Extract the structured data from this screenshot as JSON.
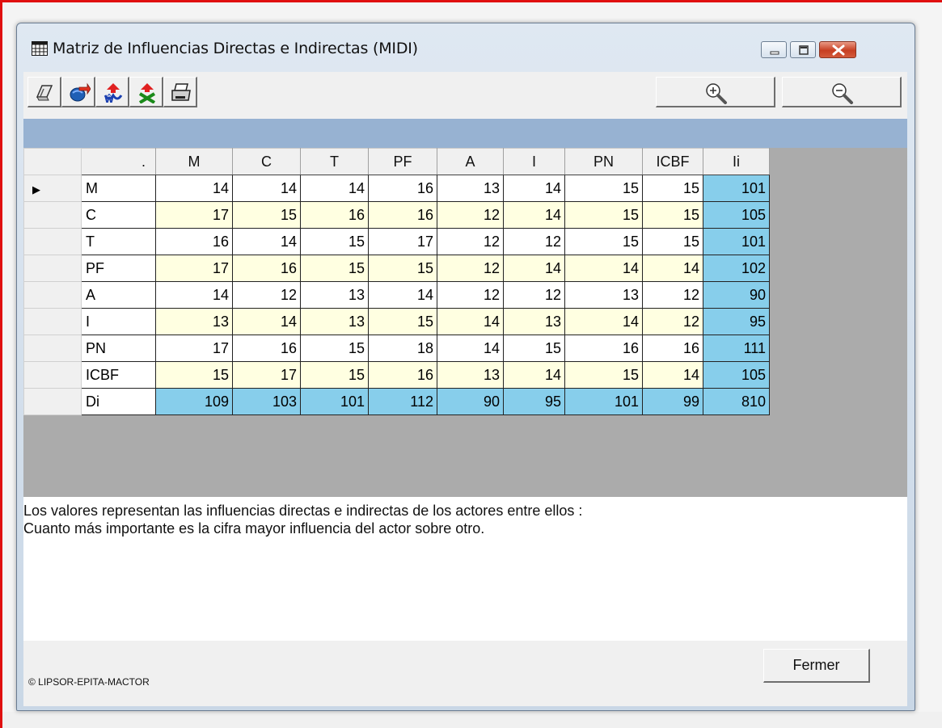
{
  "window": {
    "title": "Matriz de Influencias Directas e Indirectas (MIDI)"
  },
  "toolbar": {
    "buttons": [
      {
        "icon": "copy-icon"
      },
      {
        "icon": "export-icon"
      },
      {
        "icon": "influence-up-icon"
      },
      {
        "icon": "influence-cross-icon"
      },
      {
        "icon": "print-icon"
      }
    ],
    "zoom_in_icon": "zoom-in-icon",
    "zoom_out_icon": "zoom-out-icon"
  },
  "grid": {
    "corner_label": ".",
    "columns": [
      "M",
      "C",
      "T",
      "PF",
      "A",
      "I",
      "PN",
      "ICBF",
      "Ii"
    ],
    "rows": [
      {
        "label": "M",
        "values": [
          "14",
          "14",
          "14",
          "16",
          "13",
          "14",
          "15",
          "15",
          "101"
        ]
      },
      {
        "label": "C",
        "values": [
          "17",
          "15",
          "16",
          "16",
          "12",
          "14",
          "15",
          "15",
          "105"
        ]
      },
      {
        "label": "T",
        "values": [
          "16",
          "14",
          "15",
          "17",
          "12",
          "12",
          "15",
          "15",
          "101"
        ]
      },
      {
        "label": "PF",
        "values": [
          "17",
          "16",
          "15",
          "15",
          "12",
          "14",
          "14",
          "14",
          "102"
        ]
      },
      {
        "label": "A",
        "values": [
          "14",
          "12",
          "13",
          "14",
          "12",
          "12",
          "13",
          "12",
          "90"
        ]
      },
      {
        "label": "I",
        "values": [
          "13",
          "14",
          "13",
          "15",
          "14",
          "13",
          "14",
          "12",
          "95"
        ]
      },
      {
        "label": "PN",
        "values": [
          "17",
          "16",
          "15",
          "18",
          "14",
          "15",
          "16",
          "16",
          "111"
        ]
      },
      {
        "label": "ICBF",
        "values": [
          "15",
          "17",
          "15",
          "16",
          "13",
          "14",
          "15",
          "14",
          "105"
        ]
      },
      {
        "label": "Di",
        "values": [
          "109",
          "103",
          "101",
          "112",
          "90",
          "95",
          "101",
          "99",
          "810"
        ]
      }
    ],
    "selected_row_marker": "▶",
    "colors": {
      "total": "#87ceeb",
      "band": "#97b2d2",
      "alt_row": "#ffffe1"
    }
  },
  "description": {
    "line1": "Los valores representan las influencias directas e indirectas de los actores entre ellos :",
    "line2": "Cuanto más importante es la cifra mayor influencia del actor sobre otro."
  },
  "footer": {
    "copyright": "© LIPSOR-EPITA-MACTOR",
    "close_label": "Fermer"
  }
}
